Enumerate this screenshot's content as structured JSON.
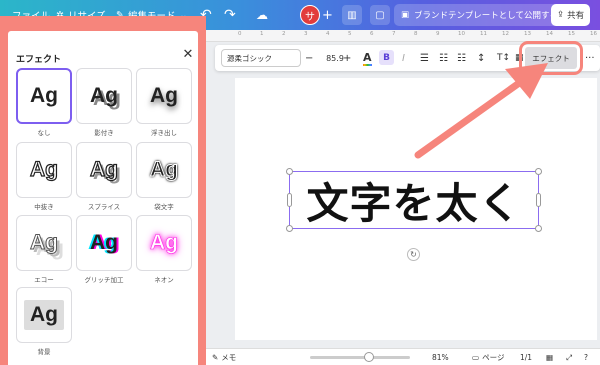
{
  "topbar": {
    "file": "ファイル",
    "resize": "リサイズ",
    "edit_mode": "編集モード",
    "undo_icon": "↶",
    "redo_icon": "↷",
    "cloud_icon": "☁",
    "avatar": "サ",
    "plus": "+",
    "chart_icon": "▥",
    "comment_icon": "▢",
    "publish": "ブランドテンプレートとして公開する",
    "share": "共有"
  },
  "effects_panel": {
    "title": "エフェクト",
    "close": "✕",
    "sample": "Ag",
    "effects": [
      {
        "label": "なし"
      },
      {
        "label": "影付き"
      },
      {
        "label": "浮き出し"
      },
      {
        "label": "中抜き"
      },
      {
        "label": "スプライス"
      },
      {
        "label": "袋文字"
      },
      {
        "label": "エコー"
      },
      {
        "label": "グリッチ加工"
      },
      {
        "label": "ネオン"
      },
      {
        "label": "背景"
      }
    ]
  },
  "toolbar": {
    "font": "源柔ゴシック",
    "minus": "−",
    "size": "85.9",
    "plus": "+",
    "color_a": "A",
    "bold": "B",
    "italic": "I",
    "align": "☰",
    "list": "☷",
    "list2": "☷",
    "spacing": "↕",
    "vertical": "T↕",
    "transparency": "▦",
    "effects": "エフェクト",
    "more": "···"
  },
  "canvas": {
    "text": "文字を太く",
    "rotate": "↻",
    "ruler": [
      "0",
      "1",
      "2",
      "3",
      "4",
      "5",
      "6",
      "7",
      "8",
      "9",
      "10",
      "11",
      "12",
      "13",
      "14",
      "15",
      "16"
    ]
  },
  "bottombar": {
    "memo": "メモ",
    "zoom": "81%",
    "pages": "ページ",
    "page_count": "1/1",
    "grid": "▦",
    "fullscreen": "⤢",
    "help": "?"
  },
  "colors": {
    "highlight": "#f6857c",
    "accent": "#7d5ef0",
    "avatar": "#e23c3c"
  }
}
